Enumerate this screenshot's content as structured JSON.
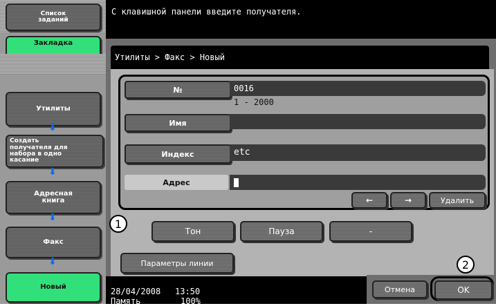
{
  "sidebar": {
    "job_list": "Список\nзаданий",
    "bookmark": "Закладка",
    "steps": [
      "Утилиты",
      "Создать\nполучателя для\nнабора в одно\nкасание",
      "Адресная\nкнига",
      "Факс",
      "Новый"
    ],
    "arrow_icon": "down-arrow-icon"
  },
  "header": {
    "message": "С клавишной панели введите получателя."
  },
  "breadcrumb": "Утилиты > Факс > Новый",
  "form": {
    "number": {
      "label": "№",
      "value": "0016",
      "range": "1 - 2000"
    },
    "name": {
      "label": "Имя",
      "value": ""
    },
    "index": {
      "label": "Индекс",
      "value": "etc"
    },
    "address": {
      "label": "Адрес",
      "value": ""
    },
    "left_arrow": "←",
    "right_arrow": "→",
    "delete": "Удалить"
  },
  "special_keys": {
    "tone": "Тон",
    "pause": "Пауза",
    "dash": "-"
  },
  "line_settings": "Параметры линии",
  "callouts": {
    "one": "1",
    "two": "2"
  },
  "footer": {
    "date": "28/04/2008",
    "time": "13:50",
    "memory_label": "Память",
    "memory_value": "100%"
  },
  "actions": {
    "cancel": "Отмена",
    "ok": "OK"
  },
  "colors": {
    "accent_green": "#31e07a",
    "arrow_blue": "#1565e0",
    "highlight_box": "#000000"
  }
}
